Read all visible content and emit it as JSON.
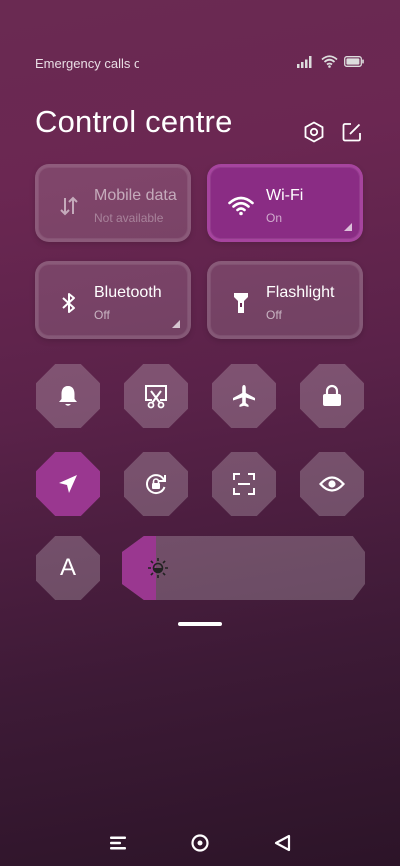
{
  "status_bar": {
    "carrier_text": "Emergency calls only",
    "icons": [
      "signal-icon",
      "wifi-icon",
      "battery-icon"
    ]
  },
  "header": {
    "title": "Control centre",
    "icons": [
      "settings-icon",
      "edit-icon"
    ]
  },
  "tiles": [
    {
      "label": "Mobile data",
      "sub": "Not available",
      "state": "unavailable",
      "icon": "mobile-data-icon"
    },
    {
      "label": "Wi-Fi",
      "sub": "On",
      "state": "on",
      "icon": "wifi-icon"
    },
    {
      "label": "Bluetooth",
      "sub": "Off",
      "state": "off",
      "icon": "bluetooth-icon"
    },
    {
      "label": "Flashlight",
      "sub": "Off",
      "state": "off",
      "icon": "flashlight-icon"
    }
  ],
  "toggles": [
    {
      "icon": "bell-icon",
      "state": "off"
    },
    {
      "icon": "screenshot-icon",
      "state": "off"
    },
    {
      "icon": "airplane-icon",
      "state": "off"
    },
    {
      "icon": "lock-icon",
      "state": "off"
    },
    {
      "icon": "location-icon",
      "state": "on"
    },
    {
      "icon": "auto-rotate-icon",
      "state": "off"
    },
    {
      "icon": "scanner-icon",
      "state": "off"
    },
    {
      "icon": "eye-icon",
      "state": "off"
    }
  ],
  "auto_brightness": {
    "label": "A",
    "state": "off"
  },
  "brightness": {
    "level_fraction": 0.14,
    "icon": "brightness-icon"
  },
  "nav": {
    "icons": [
      "recents-icon",
      "home-icon",
      "back-icon"
    ]
  },
  "colors": {
    "accent": "#9a3790",
    "tile_active": "#8a2c84"
  }
}
